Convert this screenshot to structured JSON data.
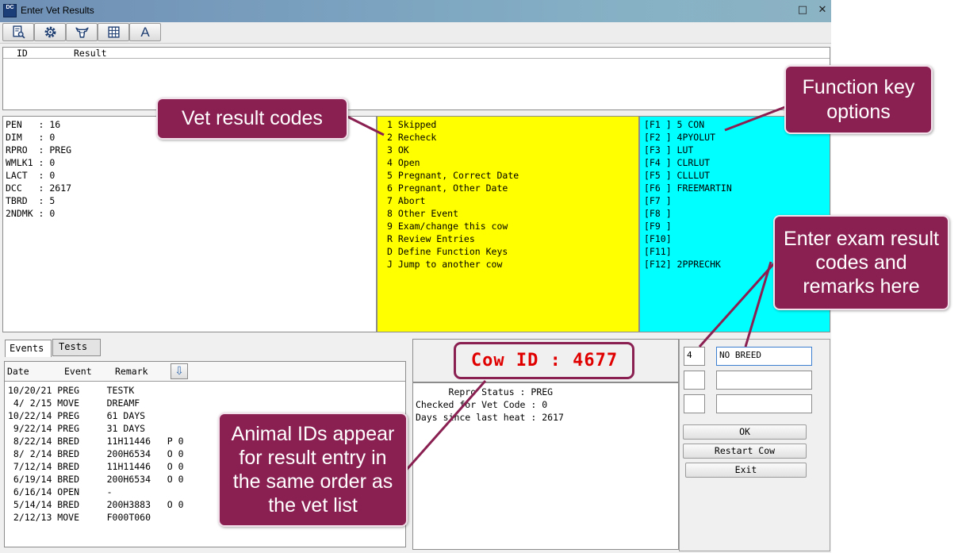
{
  "window": {
    "icon_text": "DC",
    "title": "Enter Vet Results",
    "maximize_glyph": "□",
    "close_glyph": "✕"
  },
  "toolbar": {
    "buttons": [
      {
        "name": "find-document-icon"
      },
      {
        "name": "gear-icon"
      },
      {
        "name": "cow-icon"
      },
      {
        "name": "grid-icon"
      },
      {
        "name": "font-icon",
        "text": "A"
      }
    ]
  },
  "result_list": {
    "columns": [
      "ID",
      "Result"
    ]
  },
  "cow_info": [
    "PEN   : 16",
    "DIM   : 0",
    "RPRO  : PREG",
    "WMLK1 : 0",
    "LACT  : 0",
    "DCC   : 2617",
    "TBRD  : 5",
    "2NDMK : 0"
  ],
  "vet_codes": [
    "1 Skipped",
    "2 Recheck",
    "3 OK",
    "4 Open",
    "5 Pregnant, Correct Date",
    "6 Pregnant, Other Date",
    "7 Abort",
    "8 Other Event",
    "9 Exam/change this cow",
    "R Review Entries",
    "D Define Function Keys",
    "J Jump to another cow"
  ],
  "function_keys": [
    "[F1 ] 5 CON",
    "[F2 ] 4PYOLUT",
    "[F3 ] LUT",
    "[F4 ] CLRLUT",
    "[F5 ] CLLLUT",
    "[F6 ] FREEMARTIN",
    "[F7 ]",
    "[F8 ]",
    "[F9 ]",
    "[F10]",
    "[F11]",
    "[F12] 2PPRECHK"
  ],
  "tabs": {
    "events": "Events",
    "tests": "Tests"
  },
  "events_table": {
    "headers": {
      "date": "Date",
      "event": "Event",
      "remark": "Remark"
    },
    "sort_glyph": "⇩",
    "rows": [
      "10/20/21 PREG     TESTK",
      " 4/ 2/15 MOVE     DREAMF",
      "10/22/14 PREG     61 DAYS",
      " 9/22/14 PREG     31 DAYS",
      " 8/22/14 BRED     11H11446   P 0",
      " 8/ 2/14 BRED     200H6534   O 0",
      " 7/12/14 BRED     11H11446   O 0",
      " 6/19/14 BRED     200H6534   O 0",
      " 6/16/14 OPEN     -",
      " 5/14/14 BRED     200H3883   O 0",
      " 2/12/13 MOVE     F000T060"
    ]
  },
  "cow_id": "Cow ID : 4677",
  "status_lines": [
    "      Repro Status : PREG",
    "Checked for Vet Code : 0",
    "Days since last heat : 2617"
  ],
  "entry": {
    "code1": "4",
    "remark1": "NO BREED",
    "code2": "",
    "remark2": "",
    "code3": "",
    "remark3": "",
    "ok_label": "OK",
    "restart_label": "Restart Cow",
    "exit_label": "Exit"
  },
  "callouts": {
    "vet_codes": "Vet result codes",
    "function_keys": "Function key options",
    "enter_exam": "Enter exam result codes and remarks here",
    "animal_ids": "Animal IDs appear for result entry in the same order as the vet list"
  },
  "colors": {
    "callout_bg": "#8a2052",
    "codes_bg": "#ffff00",
    "fkeys_bg": "#00ffff",
    "cow_id_text": "#e00000"
  }
}
